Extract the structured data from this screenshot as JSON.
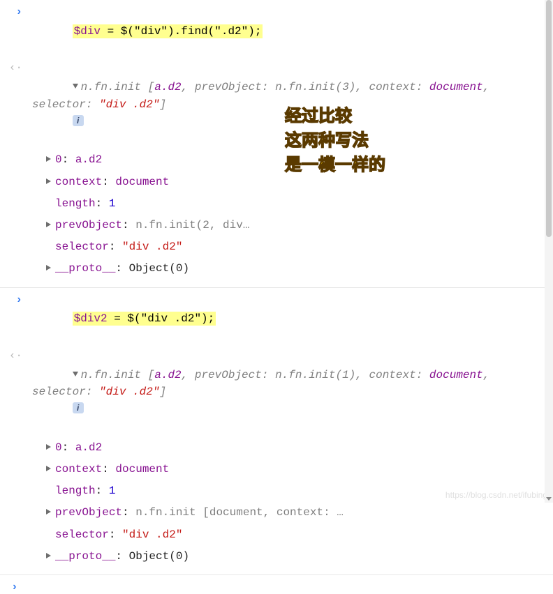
{
  "block1": {
    "input_prefix": "$div",
    "input_rest": " = $(\"div\").find(\".d2\");",
    "summary": {
      "lead": "n.fn.init [",
      "a": "a.d2",
      "mid1": ", prevObject: ",
      "prev": "n.fn.init(3)",
      "mid2": ", context: ",
      "ctx": "document",
      "mid3": ", selector: ",
      "sel": "\"div .d2\"",
      "end": "]"
    },
    "info": "i",
    "props": {
      "idx_key": "0",
      "idx_val": "a.d2",
      "ctx_key": "context",
      "ctx_val": "document",
      "len_key": "length",
      "len_val": "1",
      "prev_key": "prevObject",
      "prev_val_lead": "n.fn.init(",
      "prev_val_tail": "2, div…",
      "sel_key": "selector",
      "sel_val": "\"div .d2\"",
      "proto_key": "__proto__",
      "proto_val": "Object(0)"
    }
  },
  "block2": {
    "input_prefix": "$div2",
    "input_rest": " = $(\"div .d2\");",
    "summary": {
      "lead": "n.fn.init [",
      "a": "a.d2",
      "mid1": ", prevObject: ",
      "prev": "n.fn.init(1)",
      "mid2": ", context: ",
      "ctx": "document",
      "mid3": ", selector: ",
      "sel": "\"div .d2\"",
      "end": "]"
    },
    "info": "i",
    "props": {
      "idx_key": "0",
      "idx_val": "a.d2",
      "ctx_key": "context",
      "ctx_val": "document",
      "len_key": "length",
      "len_val": "1",
      "prev_key": "prevObject",
      "prev_val": "n.fn.init [document, context: …",
      "sel_key": "selector",
      "sel_val": "\"div .d2\"",
      "proto_key": "__proto__",
      "proto_val": "Object(0)"
    }
  },
  "annotation": {
    "l1": "经过比较",
    "l2": "这两种写法",
    "l3": "是一模一样的"
  },
  "watermark": "https://blog.csdn.net/ifubing"
}
